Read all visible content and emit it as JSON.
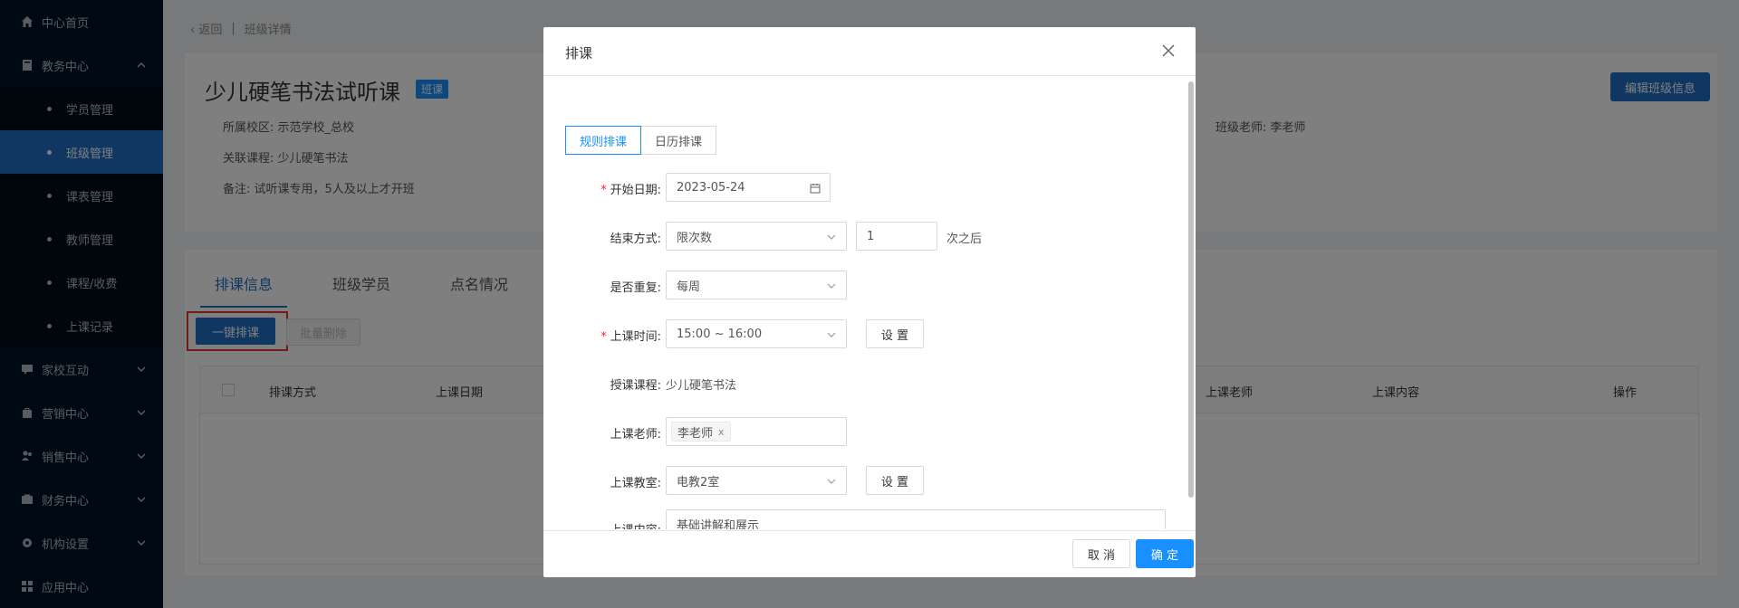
{
  "sidebar": {
    "home": "中心首页",
    "academic": "教务中心",
    "sub_items": [
      "学员管理",
      "班级管理",
      "课表管理",
      "教师管理",
      "课程/收费",
      "上课记录"
    ],
    "groups": [
      "家校互动",
      "营销中心",
      "销售中心",
      "财务中心",
      "机构设置",
      "应用中心"
    ]
  },
  "breadcrumb": {
    "back": "返回",
    "current": "班级详情"
  },
  "class_info": {
    "title": "少儿硬笔书法试听课",
    "type_tag": "班课",
    "campus": "所属校区: 示范学校_总校",
    "course": "关联课程: 少儿硬笔书法",
    "remark": "备注: 试听课专用，5人及以上才开班",
    "teacher": "班级老师: 李老师",
    "edit_label": "编辑班级信息"
  },
  "tabs": [
    "排课信息",
    "班级学员",
    "点名情况"
  ],
  "toolbar": {
    "onekey": "一键排课",
    "batch_delete": "批量删除"
  },
  "table": {
    "headers": [
      "排课方式",
      "上课日期",
      "上课老师",
      "上课内容",
      "操作"
    ]
  },
  "modal": {
    "title": "排课",
    "modes": [
      "规则排课",
      "日历排课"
    ],
    "fields": {
      "start_date": {
        "label": "开始日期:",
        "value": "2023-05-24"
      },
      "end_mode": {
        "label": "结束方式:",
        "value": "限次数",
        "count": "1",
        "suffix": "次之后"
      },
      "repeat": {
        "label": "是否重复:",
        "value": "每周"
      },
      "time": {
        "label": "上课时间:",
        "value": "15:00 ~ 16:00",
        "set": "设 置"
      },
      "course": {
        "label": "授课课程:",
        "value": "少儿硬笔书法"
      },
      "teacher": {
        "label": "上课老师:",
        "value": "李老师"
      },
      "room": {
        "label": "上课教室:",
        "value": "电教2室",
        "set": "设 置"
      },
      "content": {
        "label": "上课内容:",
        "value": "基础讲解和展示"
      }
    },
    "cancel": "取 消",
    "ok": "确 定"
  },
  "colors": {
    "primary": "#1890ff",
    "sidebar_bg": "#001529",
    "active_menu": "#1f6fc5",
    "highlight": "#e53935"
  }
}
